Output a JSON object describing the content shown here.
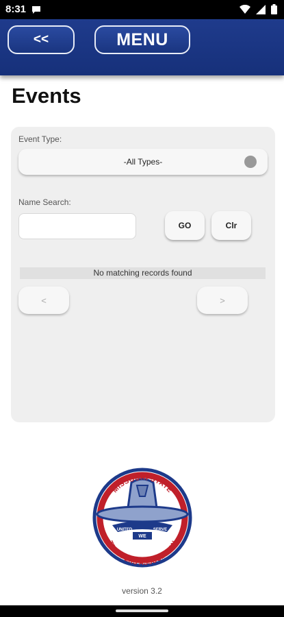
{
  "status_bar": {
    "time": "8:31"
  },
  "header": {
    "back_label": "<<",
    "menu_label": "MENU"
  },
  "page": {
    "title": "Events"
  },
  "filters": {
    "event_type_label": "Event Type:",
    "event_type_value": "-All Types-",
    "name_search_label": "Name Search:",
    "name_search_value": "",
    "go_label": "GO",
    "clear_label": "Clr"
  },
  "results": {
    "message": "No matching records found"
  },
  "pager": {
    "prev_label": "<",
    "next_label": ">"
  },
  "logo": {
    "top_text": "MISSOURI STATE",
    "bottom_text": "TROOPERS ASSOCIATION",
    "band_left": "UNITED",
    "band_right": "SERVE",
    "band_center": "WE"
  },
  "footer": {
    "version": "version 3.2"
  },
  "colors": {
    "header_blue": "#1f3b8c",
    "logo_red": "#c0202a",
    "logo_blue": "#1d3a8a"
  }
}
